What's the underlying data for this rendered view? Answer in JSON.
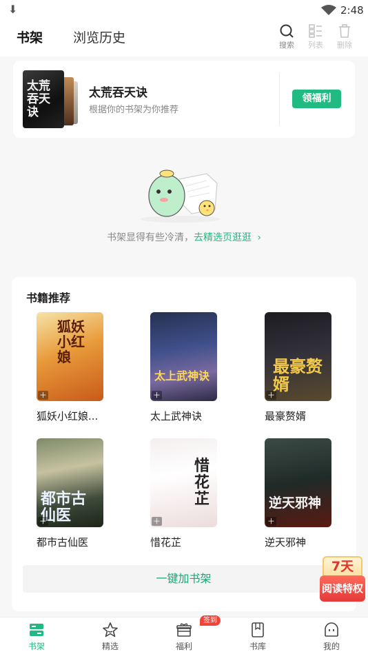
{
  "status_bar": {
    "time": "2:48",
    "download_icon": "download-icon",
    "wifi_icon": "wifi-icon"
  },
  "header": {
    "tabs": [
      {
        "label": "书架",
        "active": true
      },
      {
        "label": "浏览历史",
        "active": false
      }
    ],
    "tools": [
      {
        "label": "搜索",
        "icon": "search-icon",
        "enabled": true
      },
      {
        "label": "列表",
        "icon": "list-icon",
        "enabled": false
      },
      {
        "label": "删除",
        "icon": "trash-icon",
        "enabled": false
      }
    ]
  },
  "recommend_card": {
    "title": "太荒吞天诀",
    "subtitle": "根据你的书架为你推荐",
    "cover_text": "太荒吞天诀",
    "button_label": "领福利"
  },
  "empty_state": {
    "text": "书架显得有些冷清，",
    "link": "去精选页逛逛",
    "arrow": "›"
  },
  "books_section": {
    "title": "书籍推荐",
    "books": [
      {
        "name": "狐妖小红娘...",
        "cover_text": "狐妖小红娘"
      },
      {
        "name": "太上武神诀",
        "cover_text": "太上武神诀"
      },
      {
        "name": "最豪赘婿",
        "cover_text": "最豪赘婿"
      },
      {
        "name": "都市古仙医",
        "cover_text": "都市古仙医"
      },
      {
        "name": "惜花芷",
        "cover_text": "惜花芷"
      },
      {
        "name": "逆天邪神",
        "cover_text": "逆天邪神"
      }
    ],
    "add_all_label": "一键加书架"
  },
  "float_badge": {
    "top": "7天",
    "bottom": "阅读特权"
  },
  "bottom_nav": {
    "items": [
      {
        "label": "书架",
        "icon": "bookshelf-icon",
        "active": true
      },
      {
        "label": "精选",
        "icon": "star-icon",
        "active": false
      },
      {
        "label": "福利",
        "icon": "gift-icon",
        "active": false,
        "badge": "签到"
      },
      {
        "label": "书库",
        "icon": "library-icon",
        "active": false
      },
      {
        "label": "我的",
        "icon": "profile-icon",
        "active": false
      }
    ]
  },
  "colors": {
    "accent": "#20ba82",
    "badge_red": "#f04438"
  }
}
